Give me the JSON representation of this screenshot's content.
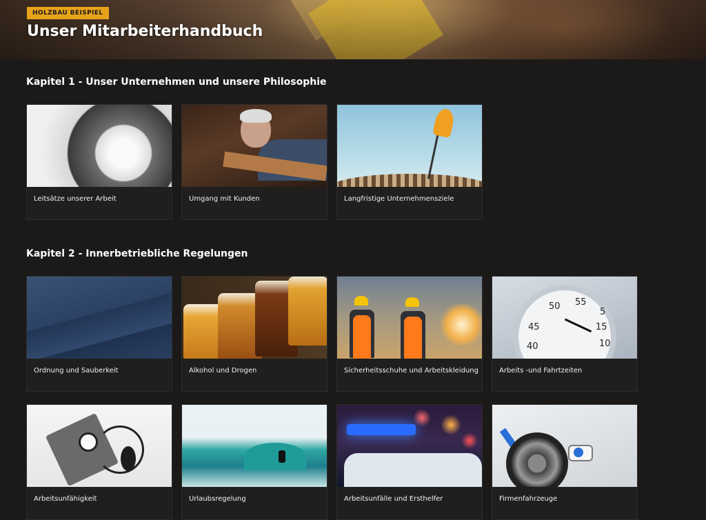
{
  "header": {
    "tag": "HOLZBAU BEISPIEL",
    "title": "Unser Mitarbeiterhandbuch"
  },
  "sections": [
    {
      "title": "Kapitel 1 - Unser Unternehmen und unsere Philosophie",
      "cards": [
        {
          "label": "Leitsätze unserer Arbeit",
          "image": "spiral-staircase"
        },
        {
          "label": "Umgang mit Kunden",
          "image": "craftsman-wood"
        },
        {
          "label": "Langfristige Unternehmensziele",
          "image": "dart-target"
        }
      ]
    },
    {
      "title": "Kapitel 2 - Innerbetriebliche Regelungen",
      "cards": [
        {
          "label": "Ordnung und Sauberkeit",
          "image": "blue-paper"
        },
        {
          "label": "Alkohol und Drogen",
          "image": "beer-glasses"
        },
        {
          "label": "Sicherheitsschuhe und Arbeitskleidung",
          "image": "safety-workers"
        },
        {
          "label": "Arbeits -und Fahrtzeiten",
          "image": "stopwatch"
        },
        {
          "label": "Arbeitsunfähigkeit",
          "image": "blood-pressure"
        },
        {
          "label": "Urlaubsregelung",
          "image": "surfer-wave"
        },
        {
          "label": "Arbeitsunfälle und Ersthelfer",
          "image": "police-lights"
        },
        {
          "label": "Firmenfahrzeuge",
          "image": "ev-charging"
        }
      ]
    }
  ],
  "stopwatch_numbers": [
    "50",
    "55",
    "5",
    "45",
    "15",
    "40",
    "10"
  ]
}
